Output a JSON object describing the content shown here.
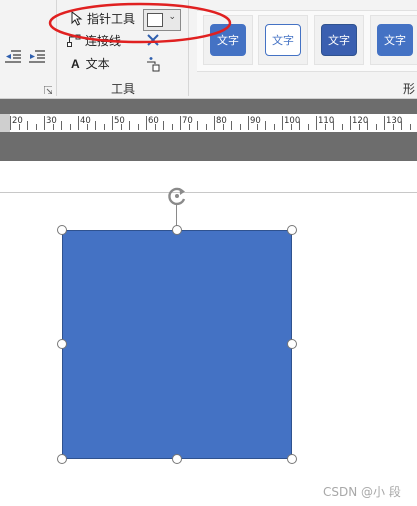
{
  "ribbon": {
    "tools": {
      "pointer_label": "指针工具",
      "connector_label": "连接线",
      "text_label": "文本",
      "group_label": "工具"
    },
    "shape_styles": {
      "thumbnails": [
        {
          "label": "文字",
          "fill": "#4472c4",
          "text_color": "#ffffff",
          "border": "#4472c4"
        },
        {
          "label": "文字",
          "fill": "#ffffff",
          "text_color": "#4472c4",
          "border": "#4472c4"
        },
        {
          "label": "文字",
          "fill": "#3a5fb0",
          "text_color": "#ffffff",
          "border": "#2f528f"
        },
        {
          "label": "文字",
          "fill": "#4472c4",
          "text_color": "#ffffff",
          "border": "#4472c4"
        }
      ],
      "group_label_partial": "形"
    }
  },
  "ruler": {
    "labels": [
      "20",
      "30",
      "40",
      "50",
      "60",
      "70",
      "80",
      "90",
      "100",
      "110",
      "120",
      "130"
    ]
  },
  "canvas": {
    "shape_fill": "#4472c4",
    "shape_border": "#2f528f"
  },
  "annotation": {
    "oval_color": "#e02020"
  },
  "watermark": "CSDN @小 段"
}
